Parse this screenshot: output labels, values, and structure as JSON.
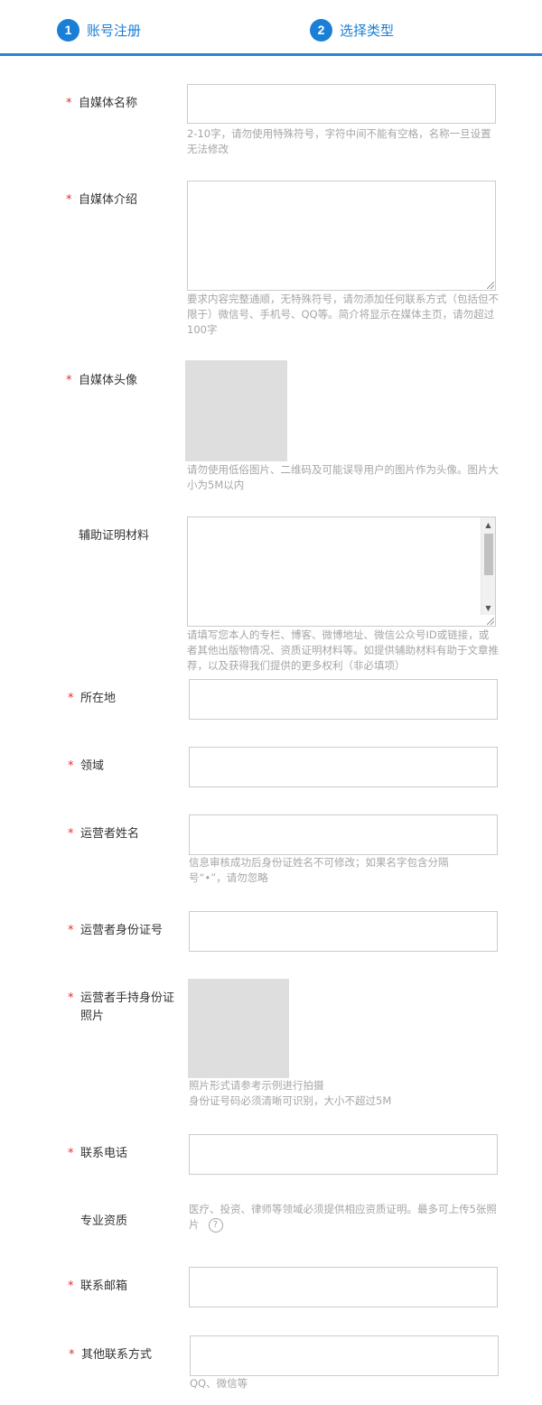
{
  "steps": [
    {
      "num": "1",
      "label": "账号注册"
    },
    {
      "num": "2",
      "label": "选择类型"
    }
  ],
  "form": {
    "name": {
      "label": "自媒体名称",
      "required": "*",
      "value": "",
      "hint": "2-10字，请勿使用特殊符号，字符中间不能有空格，名称一旦设置无法修改"
    },
    "intro": {
      "label": "自媒体介绍",
      "required": "*",
      "value": "",
      "hint": "要求内容完整通顺，无特殊符号，请勿添加任何联系方式（包括但不限于）微信号、手机号、QQ等。简介将显示在媒体主页，请勿超过100字"
    },
    "avatar": {
      "label": "自媒体头像",
      "required": "*",
      "hint": "请勿使用低俗图片、二维码及可能误导用户的图片作为头像。图片大小为5M以内"
    },
    "materials": {
      "label": "辅助证明材料",
      "value": "",
      "hint": "请填写您本人的专栏、博客、微博地址、微信公众号ID或链接，或者其他出版物情况、资质证明材料等。如提供辅助材料有助于文章推荐，以及获得我们提供的更多权利（非必填项）"
    },
    "location": {
      "label": "所在地",
      "required": "*",
      "value": ""
    },
    "field_area": {
      "label": "领域",
      "required": "*",
      "value": ""
    },
    "operator_name": {
      "label": "运营者姓名",
      "required": "*",
      "value": "",
      "hint_line1": "信息审核成功后身份证姓名不可修改；如果名字包含分隔",
      "hint_line2": "号“•”，请勿忽略"
    },
    "operator_id": {
      "label": "运营者身份证号",
      "required": "*",
      "value": ""
    },
    "operator_photo": {
      "label_line1": "运营者手持身份证",
      "label_line2": "照片",
      "required": "*",
      "hint_line1": "照片形式请参考示例进行拍摄",
      "hint_line2": "身份证号码必须清晰可识别，大小不超过5M"
    },
    "phone": {
      "label": "联系电话",
      "required": "*",
      "value": ""
    },
    "qualification": {
      "label": "专业资质",
      "hint": "医疗、投资、律师等领域必须提供相应资质证明。最多可上传5张照片",
      "help_glyph": "?"
    },
    "email": {
      "label": "联系邮箱",
      "required": "*",
      "value": ""
    },
    "other_contact": {
      "label": "其他联系方式",
      "required": "*",
      "value": "",
      "hint": "QQ、微信等"
    }
  },
  "icons": {
    "scroll_up": "▲",
    "scroll_down": "▼"
  },
  "colors": {
    "accent": "#1a7fd6",
    "required": "#e0302f",
    "hint": "#a6a6a6",
    "upload_placeholder": "#dedede"
  }
}
